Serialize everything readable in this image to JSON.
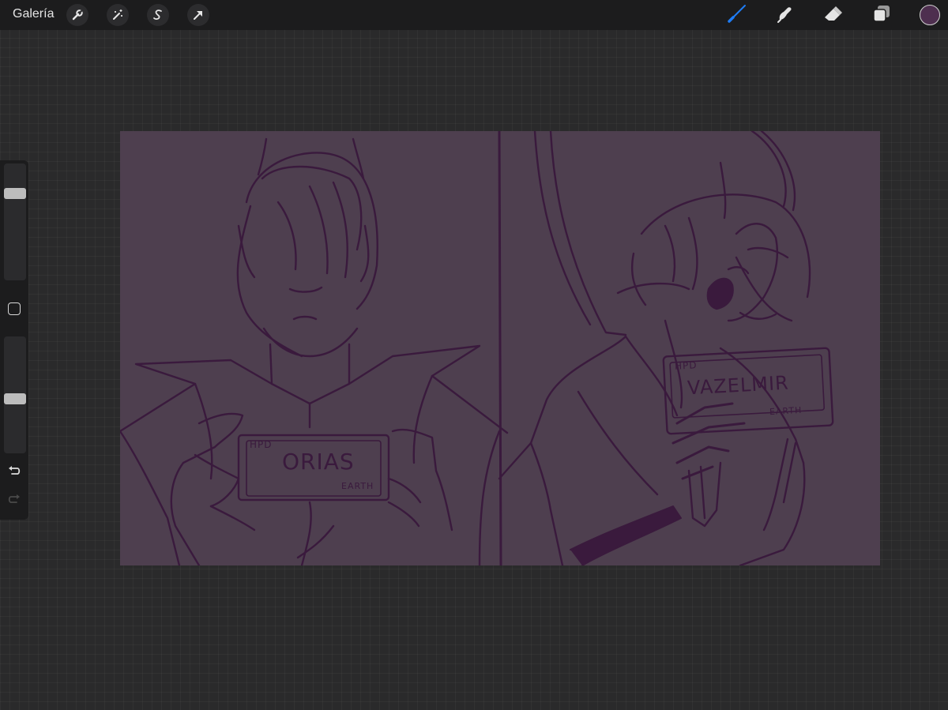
{
  "app": {
    "gallery_label": "Galería"
  },
  "colors": {
    "brush_active": "#1e7cf5",
    "current_color": "#4e2f4f",
    "sketch_line": "#3a1a3d",
    "canvas_bg": "#4e3f4f"
  },
  "toolbar_left": [
    {
      "icon": "wrench-icon"
    },
    {
      "icon": "magic-wand-icon"
    },
    {
      "icon": "selection-s-icon"
    },
    {
      "icon": "transform-arrow-icon"
    }
  ],
  "toolbar_right": [
    {
      "icon": "brush-icon",
      "active": true
    },
    {
      "icon": "smudge-icon"
    },
    {
      "icon": "eraser-icon"
    },
    {
      "icon": "layers-icon"
    }
  ],
  "sidebar": {
    "brush_size_level": 0.77,
    "opacity_level": 0.46
  },
  "artwork": {
    "left_card": {
      "hpd": "HPD",
      "name": "ORIAS",
      "place": "EARTH"
    },
    "right_card": {
      "hpd": "HPD",
      "name": "VAZELMIR",
      "place": "EARTH"
    }
  }
}
